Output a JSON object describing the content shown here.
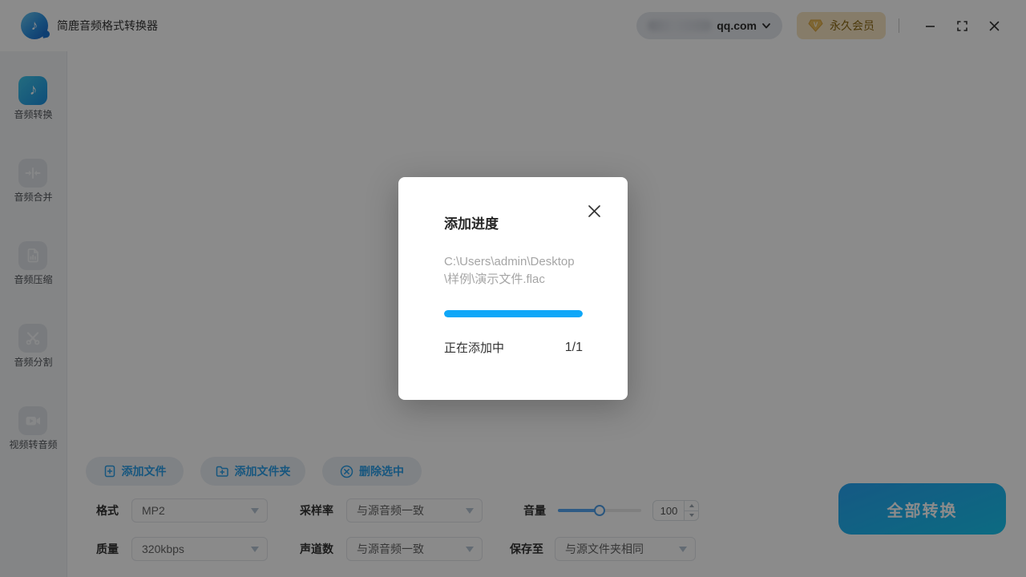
{
  "app": {
    "title": "简鹿音频格式转换器",
    "logo_icon": "music-note-circle"
  },
  "topbar": {
    "account": {
      "email_visible": "qq.com",
      "chevron_icon": "chevron-down"
    },
    "vip": {
      "label": "永久会员",
      "icon": "v-gem"
    },
    "window_controls": {
      "minimize_icon": "minus",
      "maximize_icon": "fullscreen-corners",
      "close_icon": "cross"
    }
  },
  "sidebar": {
    "items": [
      {
        "label": "音频转换",
        "icon": "music-note",
        "active": true
      },
      {
        "label": "音频合并",
        "icon": "merge-arrows",
        "active": false
      },
      {
        "label": "音频压缩",
        "icon": "compress-file",
        "active": false
      },
      {
        "label": "音频分割",
        "icon": "scissors",
        "active": false
      },
      {
        "label": "视频转音频",
        "icon": "video-camera",
        "active": false
      }
    ]
  },
  "toolbar": {
    "add_file": {
      "label": "添加文件",
      "icon": "file-plus"
    },
    "add_folder": {
      "label": "添加文件夹",
      "icon": "folder-plus"
    },
    "delete_selected": {
      "label": "删除选中",
      "icon": "circle-cross"
    }
  },
  "settings": {
    "format": {
      "label": "格式",
      "value": "MP2"
    },
    "sample_rate": {
      "label": "采样率",
      "value": "与源音频一致"
    },
    "volume": {
      "label": "音量",
      "value": "100",
      "slider_percent": 50
    },
    "quality": {
      "label": "质量",
      "value": "320kbps"
    },
    "channels": {
      "label": "声道数",
      "value": "与源音频一致"
    },
    "save_to": {
      "label": "保存至",
      "value": "与源文件夹相同"
    }
  },
  "convert": {
    "label": "全部转换"
  },
  "modal": {
    "title": "添加进度",
    "file_path": "C:\\Users\\admin\\Desktop\\样例\\演示文件.flac",
    "progress_percent": 100,
    "status": "正在添加中",
    "count": "1/1",
    "close_icon": "cross"
  },
  "colors": {
    "accent_blue": "#2b9fe8",
    "progress_blue": "#0fa7f8",
    "convert_gradient": [
      "#27a4f2",
      "#17c4ee"
    ],
    "vip_bg": "#f6e4c0",
    "vip_text": "#8b6914",
    "overlay": "rgba(0,0,0,0.455)"
  }
}
